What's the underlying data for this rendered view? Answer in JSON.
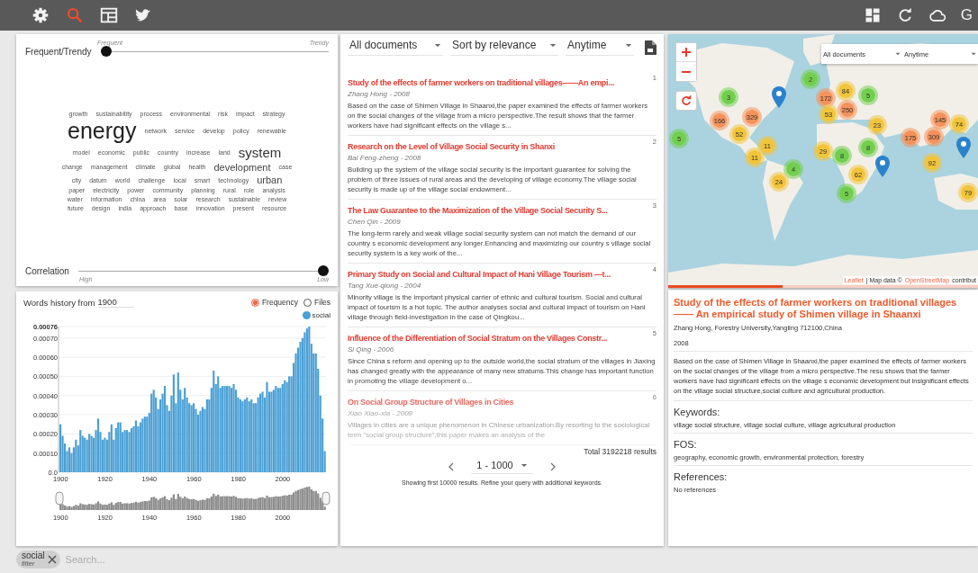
{
  "toolbar": {
    "left": [
      {
        "kind": "settings",
        "selected": false
      },
      {
        "kind": "search",
        "selected": true
      },
      {
        "kind": "table",
        "selected": false
      },
      {
        "kind": "bird",
        "selected": false
      }
    ],
    "right": [
      {
        "kind": "dashboard"
      },
      {
        "kind": "refresh"
      },
      {
        "kind": "cloud"
      }
    ],
    "account_letter": "G"
  },
  "word_cloud": {
    "top_slider": {
      "label": "Frequent/Trendy",
      "left_hint": "Frequent",
      "right_hint": "Trendy",
      "level": 0
    },
    "words": [
      {
        "text": "growth",
        "kind": "small"
      },
      {
        "text": "sustainability",
        "kind": "small"
      },
      {
        "text": "process",
        "kind": "small"
      },
      {
        "text": "environmental",
        "kind": "small"
      },
      {
        "text": "risk",
        "kind": "small"
      },
      {
        "text": "impact",
        "kind": "small"
      },
      {
        "text": "strategy",
        "kind": "small"
      },
      {
        "text": "energy",
        "kind": "huge"
      },
      {
        "text": "network",
        "kind": "small"
      },
      {
        "text": "service",
        "kind": "small"
      },
      {
        "text": "develop",
        "kind": "small"
      },
      {
        "text": "policy",
        "kind": "small"
      },
      {
        "text": "renewable",
        "kind": "small"
      },
      {
        "text": "model",
        "kind": "small"
      },
      {
        "text": "economic",
        "kind": "small"
      },
      {
        "text": "public",
        "kind": "small"
      },
      {
        "text": "country",
        "kind": "small"
      },
      {
        "text": "increase",
        "kind": "small"
      },
      {
        "text": "land",
        "kind": "small"
      },
      {
        "text": "system",
        "kind": "large"
      },
      {
        "text": "change",
        "kind": "small"
      },
      {
        "text": "management",
        "kind": "small"
      },
      {
        "text": "climate",
        "kind": "small"
      },
      {
        "text": "global",
        "kind": "small"
      },
      {
        "text": "health",
        "kind": "small"
      },
      {
        "text": "development",
        "kind": "medium"
      },
      {
        "text": "case",
        "kind": "small"
      },
      {
        "text": "city",
        "kind": "small"
      },
      {
        "text": "datum",
        "kind": "small"
      },
      {
        "text": "world",
        "kind": "small"
      },
      {
        "text": "challenge",
        "kind": "small"
      },
      {
        "text": "local",
        "kind": "small"
      },
      {
        "text": "smart",
        "kind": "small"
      },
      {
        "text": "technology",
        "kind": "small"
      },
      {
        "text": "urban",
        "kind": "medium"
      },
      {
        "text": "paper",
        "kind": "small"
      },
      {
        "text": "electricity",
        "kind": "small"
      },
      {
        "text": "power",
        "kind": "small"
      },
      {
        "text": "community",
        "kind": "small"
      },
      {
        "text": "planning",
        "kind": "small"
      },
      {
        "text": "rural",
        "kind": "small"
      },
      {
        "text": "role",
        "kind": "small"
      },
      {
        "text": "analysis",
        "kind": "small"
      },
      {
        "text": "water",
        "kind": "small"
      },
      {
        "text": "information",
        "kind": "small"
      },
      {
        "text": "china",
        "kind": "small"
      },
      {
        "text": "area",
        "kind": "small"
      },
      {
        "text": "solar",
        "kind": "small"
      },
      {
        "text": "research",
        "kind": "small"
      },
      {
        "text": "sustainable",
        "kind": "small"
      },
      {
        "text": "review",
        "kind": "small"
      },
      {
        "text": "future",
        "kind": "small"
      },
      {
        "text": "design",
        "kind": "small"
      },
      {
        "text": "india",
        "kind": "small"
      },
      {
        "text": "approach",
        "kind": "small"
      },
      {
        "text": "base",
        "kind": "small"
      },
      {
        "text": "innovation",
        "kind": "small"
      },
      {
        "text": "present",
        "kind": "small"
      },
      {
        "text": "resource",
        "kind": "small"
      }
    ],
    "bottom_slider": {
      "label": "Correlation",
      "left_hint": "High",
      "right_hint": "Low",
      "level": 1
    }
  },
  "history": {
    "title": "Words history from",
    "year_value": "1900",
    "modes": [
      {
        "label": "Frequency",
        "selected": true
      },
      {
        "label": "Files",
        "selected": false
      }
    ],
    "chart_data": {
      "type": "bar",
      "x": [
        1900,
        1901,
        1902,
        1903,
        1904,
        1905,
        1906,
        1907,
        1908,
        1909,
        1910,
        1911,
        1912,
        1913,
        1914,
        1915,
        1916,
        1917,
        1918,
        1919,
        1920,
        1921,
        1922,
        1923,
        1924,
        1925,
        1926,
        1927,
        1928,
        1929,
        1930,
        1931,
        1932,
        1933,
        1934,
        1935,
        1936,
        1937,
        1938,
        1939,
        1940,
        1941,
        1942,
        1943,
        1944,
        1945,
        1946,
        1947,
        1948,
        1949,
        1950,
        1951,
        1952,
        1953,
        1954,
        1955,
        1956,
        1957,
        1958,
        1959,
        1960,
        1961,
        1962,
        1963,
        1964,
        1965,
        1966,
        1967,
        1968,
        1969,
        1970,
        1971,
        1972,
        1973,
        1974,
        1975,
        1976,
        1977,
        1978,
        1979,
        1980,
        1981,
        1982,
        1983,
        1984,
        1985,
        1986,
        1987,
        1988,
        1989,
        1990,
        1991,
        1992,
        1993,
        1994,
        1995,
        1996,
        1997,
        1998,
        1999,
        2000,
        2001,
        2002,
        2003,
        2004,
        2005,
        2006,
        2007,
        2008,
        2009,
        2010,
        2011,
        2012,
        2013,
        2014,
        2015,
        2016,
        2017,
        2018,
        2019
      ],
      "series": [
        {
          "name": "social",
          "color": "#4a9fd4",
          "values": [
            0.00025,
            0.00019,
            0.00015,
            0.00011,
            0.00013,
            0.0001,
            0.00013,
            0.00017,
            0.00014,
            0.00022,
            0.00019,
            0.00018,
            0.00017,
            0.0002,
            0.00019,
            0.00018,
            0.00022,
            0.00028,
            0.00021,
            0.00017,
            0.00018,
            0.00017,
            0.00021,
            0.00025,
            0.00017,
            0.00023,
            0.00026,
            0.00026,
            0.00021,
            0.00022,
            0.00022,
            0.00021,
            0.00023,
            0.00024,
            0.00027,
            0.00024,
            0.00026,
            0.00028,
            0.00029,
            0.00029,
            0.00031,
            0.00041,
            0.00043,
            0.00039,
            0.00033,
            0.00038,
            0.00041,
            0.00045,
            0.00035,
            0.00032,
            0.0004,
            0.00051,
            0.00036,
            0.00052,
            0.00043,
            0.00038,
            0.00044,
            0.00039,
            0.00036,
            0.00035,
            0.00036,
            0.00033,
            0.0003,
            0.00032,
            0.00034,
            0.00033,
            0.00038,
            0.00038,
            0.00044,
            0.00053,
            0.00046,
            0.0005,
            0.00044,
            0.00045,
            0.00045,
            0.00045,
            0.00045,
            0.00044,
            0.00046,
            0.00043,
            0.00039,
            0.00038,
            0.00037,
            0.00038,
            0.00039,
            0.00037,
            0.00038,
            0.00036,
            0.00036,
            0.00039,
            0.00041,
            0.00042,
            0.00039,
            0.00047,
            0.00042,
            0.00042,
            0.00043,
            0.00045,
            0.00044,
            0.00044,
            0.00046,
            0.00048,
            0.00047,
            0.0005,
            0.0005,
            0.00057,
            0.00062,
            0.00065,
            0.00068,
            0.0007,
            0.00073,
            0.00075,
            0.00076,
            0.00067,
            0.00062,
            0.00062,
            0.00054,
            0.0004,
            0.00028,
            0.00011
          ]
        }
      ],
      "xlim": [
        1899.5,
        2019.5
      ],
      "ylim": [
        0,
        0.00076
      ],
      "grid": true,
      "xticks": [
        {
          "value": 1900,
          "label": "1900"
        },
        {
          "value": 1920,
          "label": "1920"
        },
        {
          "value": 1940,
          "label": "1940"
        },
        {
          "value": 1960,
          "label": "1960"
        },
        {
          "value": 1980,
          "label": "1980"
        },
        {
          "value": 2000,
          "label": "2000"
        }
      ],
      "yticks": [
        {
          "value": 0,
          "label": "0.0"
        },
        {
          "value": 0.0001,
          "label": "0.00010"
        },
        {
          "value": 0.0002,
          "label": "0.00020"
        },
        {
          "value": 0.0003,
          "label": "0.00030"
        },
        {
          "value": 0.0004,
          "label": "0.00040"
        },
        {
          "value": 0.0005,
          "label": "0.00050"
        },
        {
          "value": 0.0006,
          "label": "0.00060"
        },
        {
          "value": 0.0007,
          "label": "0.00070"
        },
        {
          "value": 0.00076,
          "label": "0.00076"
        }
      ]
    },
    "overview_axis_labels": [
      "1900",
      "1920",
      "1940",
      "1960",
      "1980",
      "2000"
    ]
  },
  "results": {
    "filters": [
      "All documents",
      "Sort by relevance",
      "Anytime"
    ],
    "items": [
      {
        "number": "1",
        "title": "Study of the effects of farmer workers on traditional villages——An empi...",
        "byline": "Zhang Hong - 2008",
        "abstract": "Based on the case of Shimen Village in Shaanxi,the paper examined the effects of farmer workers on the social changes of the village from a micro perspective.The result shows that the farmer workers have had significant effects on the village s..."
      },
      {
        "number": "2",
        "title": "Research on the Level of Village Social Security in Shanxi",
        "byline": "Bai Feng-zheng - 2008",
        "abstract": "Building up the system of the village social security is the important guarantee for solving the problem of three issues of rural areas and the developing of village economy.The village social security is made up of the village social endowment..."
      },
      {
        "number": "3",
        "title": "The Law Guarantee to the Maximization of the Village Social Security S...",
        "byline": "Chen Qin - 2009",
        "abstract": "The long-term rarely and weak village social security system can not match the demand of our country s economic development any longer.Enhancing and maximizing our country s village social security system is a key work of the..."
      },
      {
        "number": "4",
        "title": "Primary Study on Social and Cultural Impact of Hani Village Tourism —t...",
        "byline": "Tang Xue-qiong - 2004",
        "abstract": "Minority village is the important physical carrier of ethnic and cultural tourism. Social and cultural impact of tourism is a hot topic. The author analyses social and cultural impact of tourism on Hani village through field-investigation in the case of Qingkou..."
      },
      {
        "number": "5",
        "title": "Influence of the Differentiation of Social Stratum on the Villages Constr...",
        "byline": "Si Qing - 2006",
        "abstract": "Since China s reform and opening up to the outside world,the social stratum of the villages in Jiaxing has changed greatly with the appearance of many new stratums.This change has important function in promoting the village development o..."
      },
      {
        "number": "6",
        "title": "On Social Group Structure of Villages in Cities",
        "byline": "Xiao Xiao-xia - 2008",
        "abstract": "Villages in cities are a unique phenomenon in Chinese urbanization.By resorting to the sociological term \"social group structure\",this paper makes an analysis of the"
      }
    ],
    "total": "Total 3192218 results",
    "page_range": "1 - 1000",
    "note": "Showing first 10000 results. Refine your query with additional keywords."
  },
  "map": {
    "filters": [
      "All documents",
      "Anytime"
    ],
    "clusters": [
      {
        "count": "2",
        "color": "#72cf4e"
      },
      {
        "count": "84",
        "color": "#f2c43a"
      },
      {
        "count": "5",
        "color": "#72cf4e"
      },
      {
        "count": "3",
        "color": "#72cf4e"
      },
      {
        "count": "172",
        "color": "#f5925a"
      },
      {
        "count": "250",
        "color": "#f5925a"
      },
      {
        "count": "53",
        "color": "#f2c43a"
      },
      {
        "count": "329",
        "color": "#f5925a"
      },
      {
        "count": "166",
        "color": "#f5925a"
      },
      {
        "count": "23",
        "color": "#f2c43a"
      },
      {
        "count": "145",
        "color": "#f5925a"
      },
      {
        "count": "74",
        "color": "#f2c43a"
      },
      {
        "count": "52",
        "color": "#f2c43a"
      },
      {
        "count": "175",
        "color": "#f5925a"
      },
      {
        "count": "309",
        "color": "#f5925a"
      },
      {
        "count": "5",
        "color": "#72cf4e"
      },
      {
        "count": "11",
        "color": "#f2c43a"
      },
      {
        "count": "8",
        "color": "#72cf4e"
      },
      {
        "count": "29",
        "color": "#f2c43a"
      },
      {
        "count": "8",
        "color": "#72cf4e"
      },
      {
        "count": "11",
        "color": "#f2c43a"
      },
      {
        "count": "92",
        "color": "#f2c43a"
      },
      {
        "count": "4",
        "color": "#72cf4e"
      },
      {
        "count": "62",
        "color": "#f2c43a"
      },
      {
        "count": "24",
        "color": "#f2c43a"
      },
      {
        "count": "5",
        "color": "#72cf4e"
      },
      {
        "count": "79",
        "color": "#f2c43a"
      }
    ],
    "attribution": [
      {
        "kind": "link",
        "text": "Leaflet"
      },
      {
        "kind": "text",
        "text": "| Map data ©"
      },
      {
        "kind": "link",
        "text": "OpenStreetMap"
      },
      {
        "kind": "text",
        "text": "contribut"
      }
    ],
    "progress": {
      "level": 0.37
    }
  },
  "detail": {
    "title": "Study of the effects of farmer workers on traditional villages—— An empirical study of Shimen village in Shaanxi",
    "authors": "Zhang Hong, Forestry University,Yangling 712100,China",
    "year": "2008",
    "abstract": "Based on the case of Shimen Village in Shaanxi,the paper examined the effects of farmer workers on the social changes of the village from a micro perspective.The resu shows that the farmer workers have had significant effects on the village s economic development but insignificant effects on the village social structure,social culture and agricultural production.",
    "sections": [
      {
        "heading": "Keywords:",
        "body": "village social structure, village social culture, village agricultural production"
      },
      {
        "heading": "FOS:",
        "body": "geography, economic growth, environmental protection, forestry"
      },
      {
        "heading": "References:",
        "body": "No references"
      }
    ]
  },
  "search_bar": {
    "chips": [
      {
        "label": "social",
        "sublabel": "filter"
      }
    ],
    "placeholder": "Search..."
  }
}
